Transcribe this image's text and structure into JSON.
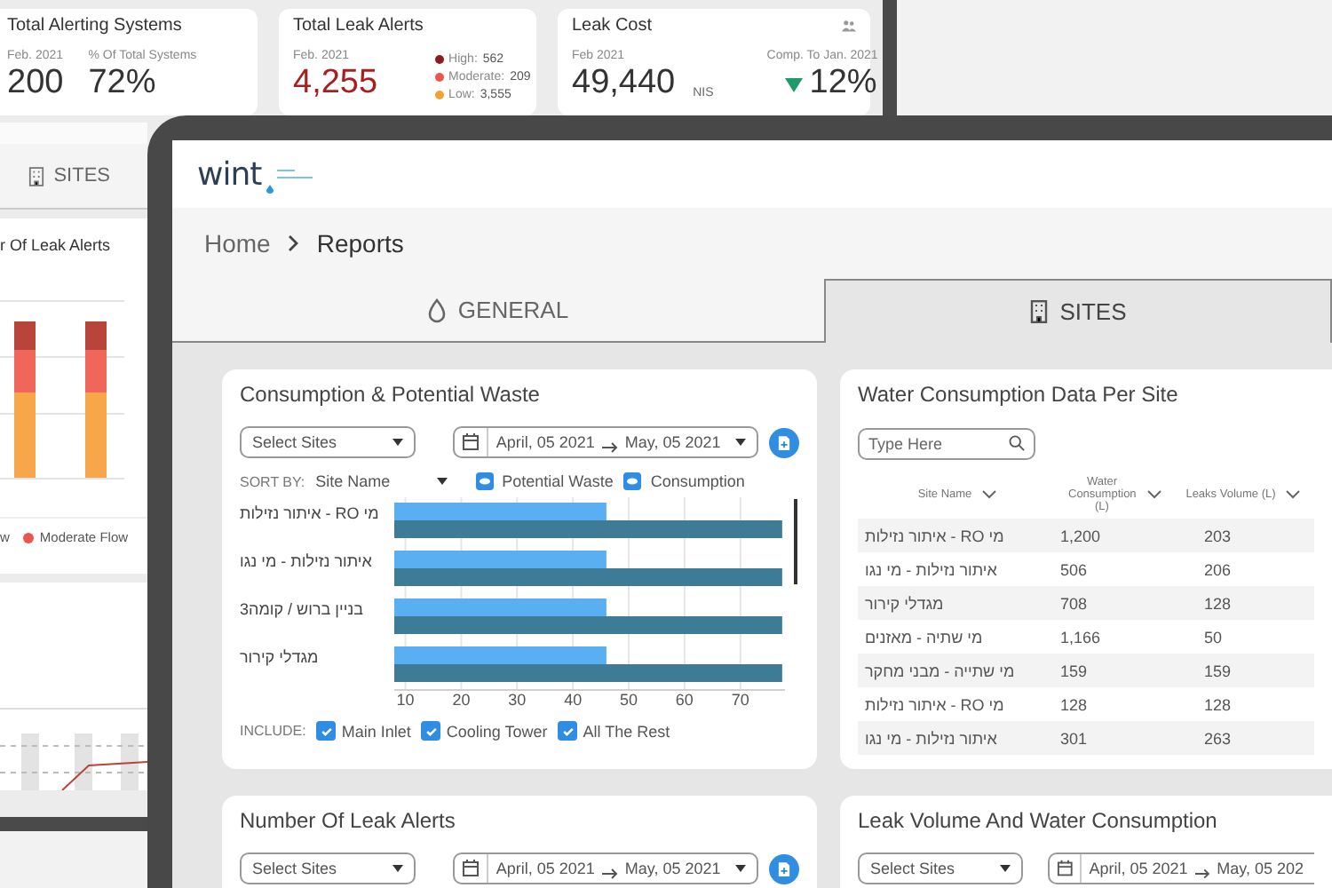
{
  "back_window": {
    "stat_cards": [
      {
        "kind": "share",
        "title": "Total Alerting Systems",
        "period": "Feb. 2021",
        "value": "200",
        "share_label": "% Of Total Systems",
        "share": "72%"
      },
      {
        "kind": "alerts",
        "title": "Total Leak Alerts",
        "period": "Feb. 2021",
        "value": "4,255",
        "breakdown": [
          {
            "label": "High:",
            "count": "562",
            "color": "#8e1b1b"
          },
          {
            "label": "Moderate:",
            "count": "209",
            "color": "#e8564c"
          },
          {
            "label": "Low:",
            "count": "3,555",
            "color": "#f0a232"
          }
        ]
      },
      {
        "kind": "cost",
        "title": "Leak Cost",
        "period": "Feb 2021",
        "value": "49,440",
        "unit": "NIS",
        "compare_label": "Comp. To Jan. 2021",
        "change": "12%"
      }
    ],
    "tab": {
      "label": "SITES"
    },
    "chart_card": {
      "title": "r Of Leak Alerts",
      "legend": [
        {
          "label": "w"
        },
        {
          "label": "Moderate Flow",
          "color": "#e8564c"
        }
      ]
    }
  },
  "logo": "wint",
  "breadcrumb": [
    "Home",
    "Reports"
  ],
  "tabs": [
    {
      "label": "GENERAL",
      "selected": false
    },
    {
      "label": "SITES",
      "selected": true
    }
  ],
  "consumption_card": {
    "title": "Consumption & Potential Waste",
    "select": "Select Sites",
    "date_from": "April, 05 2021",
    "date_to": "May, 05 2021",
    "sort_label": "SORT BY:",
    "sort_value": "Site Name",
    "include_label": "INCLUDE:",
    "include": [
      {
        "label": "Main Inlet",
        "checked": true
      },
      {
        "label": "Cooling Tower",
        "checked": true
      },
      {
        "label": "All The Rest",
        "checked": true
      }
    ],
    "chart_data": {
      "type": "bar",
      "orientation": "horizontal",
      "categories": [
        "איתור נזילות - RO מי",
        "איתור נזילות - מי נגו",
        "בניין ברוש / קומה3",
        "מגדלי קירור"
      ],
      "series": [
        {
          "name": "Potential Waste",
          "color": "#5aaef2",
          "values": [
            46,
            46,
            46,
            46
          ]
        },
        {
          "name": "Consumption",
          "color": "#3d7b96",
          "values": [
            77.5,
            77.5,
            77.5,
            77.5
          ]
        }
      ],
      "xlim": [
        8,
        78
      ],
      "xticks": [
        10,
        20,
        30,
        40,
        50,
        60,
        70
      ],
      "grid": true
    }
  },
  "table_card": {
    "title": "Water Consumption Data Per Site",
    "search_placeholder": "Type Here",
    "columns": [
      "Site Name",
      "Water Consumption (L)",
      "Leaks Volume (L)"
    ],
    "rows": [
      [
        "איתור נזילות - RO מי",
        "1,200",
        "203"
      ],
      [
        "איתור נזילות - מי נגו",
        "506",
        "206"
      ],
      [
        "מגדלי קירור",
        "708",
        "128"
      ],
      [
        "מי שתיה - מאזנים",
        "1,166",
        "50"
      ],
      [
        "מי שתייה - מבני מחקר",
        "159",
        "159"
      ],
      [
        "איתור נזילות - RO מי",
        "128",
        "128"
      ],
      [
        "איתור נזילות - מי נגו",
        "301",
        "263"
      ]
    ]
  },
  "bottom_cards": [
    {
      "title": "Number Of Leak Alerts",
      "select": "Select Sites",
      "date_from": "April, 05 2021",
      "date_to": "May, 05 2021",
      "export": true
    },
    {
      "title": "Leak Volume And Water Consumption",
      "select": "Select Sites",
      "date_from": "April, 05 2021",
      "date_to": "May, 05 202",
      "export": false
    }
  ]
}
